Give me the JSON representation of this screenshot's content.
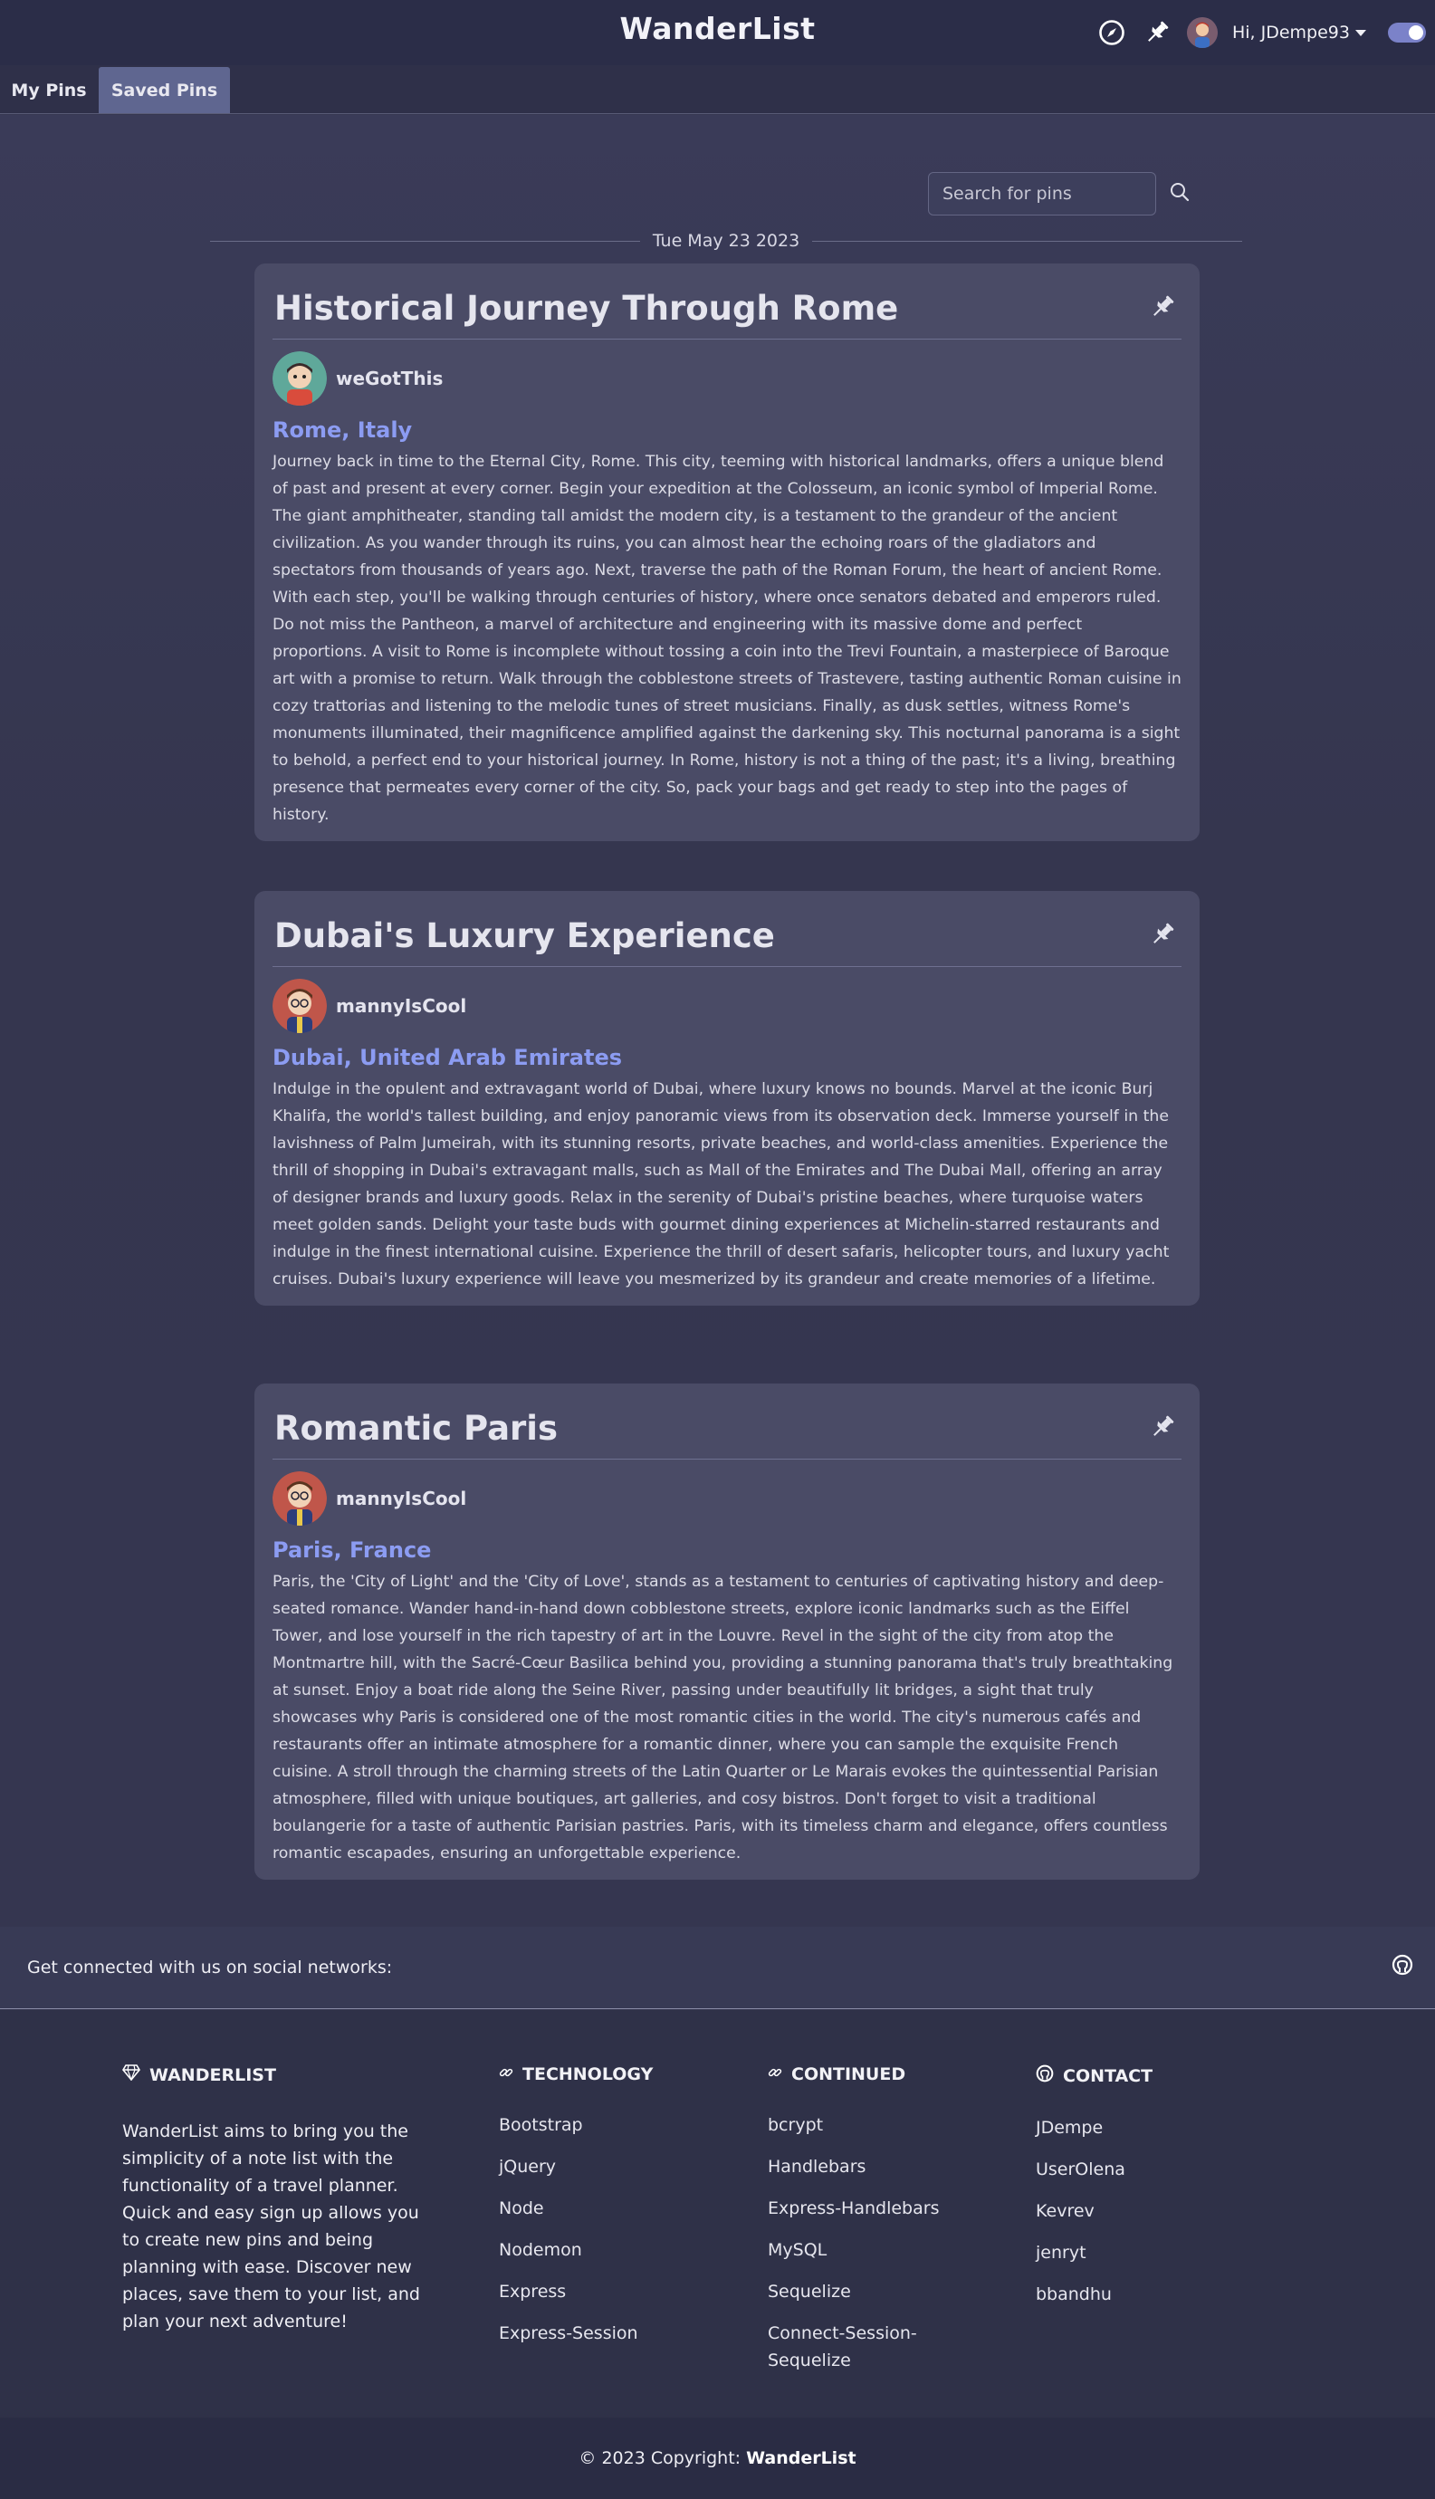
{
  "nav": {
    "brand": "WanderList",
    "greeting": "Hi, JDempe93"
  },
  "tabs": [
    {
      "label": "My Pins"
    },
    {
      "label": "Saved Pins"
    }
  ],
  "search": {
    "placeholder": "Search for pins"
  },
  "date": "Tue May 23 2023",
  "pins": [
    {
      "title": "Historical Journey Through Rome",
      "author": "weGotThis",
      "location": "Rome, Italy",
      "description": "Journey back in time to the Eternal City, Rome. This city, teeming with historical landmarks, offers a unique blend of past and present at every corner. Begin your expedition at the Colosseum, an iconic symbol of Imperial Rome. The giant amphitheater, standing tall amidst the modern city, is a testament to the grandeur of the ancient civilization. As you wander through its ruins, you can almost hear the echoing roars of the gladiators and spectators from thousands of years ago. Next, traverse the path of the Roman Forum, the heart of ancient Rome. With each step, you'll be walking through centuries of history, where once senators debated and emperors ruled. Do not miss the Pantheon, a marvel of architecture and engineering with its massive dome and perfect proportions. A visit to Rome is incomplete without tossing a coin into the Trevi Fountain, a masterpiece of Baroque art with a promise to return. Walk through the cobblestone streets of Trastevere, tasting authentic Roman cuisine in cozy trattorias and listening to the melodic tunes of street musicians. Finally, as dusk settles, witness Rome's monuments illuminated, their magnificence amplified against the darkening sky. This nocturnal panorama is a sight to behold, a perfect end to your historical journey. In Rome, history is not a thing of the past; it's a living, breathing presence that permeates every corner of the city. So, pack your bags and get ready to step into the pages of history."
    },
    {
      "title": "Dubai's Luxury Experience",
      "author": "mannyIsCool",
      "location": "Dubai, United Arab Emirates",
      "description": "Indulge in the opulent and extravagant world of Dubai, where luxury knows no bounds. Marvel at the iconic Burj Khalifa, the world's tallest building, and enjoy panoramic views from its observation deck. Immerse yourself in the lavishness of Palm Jumeirah, with its stunning resorts, private beaches, and world-class amenities. Experience the thrill of shopping in Dubai's extravagant malls, such as Mall of the Emirates and The Dubai Mall, offering an array of designer brands and luxury goods. Relax in the serenity of Dubai's pristine beaches, where turquoise waters meet golden sands. Delight your taste buds with gourmet dining experiences at Michelin-starred restaurants and indulge in the finest international cuisine. Experience the thrill of desert safaris, helicopter tours, and luxury yacht cruises. Dubai's luxury experience will leave you mesmerized by its grandeur and create memories of a lifetime."
    },
    {
      "title": "Romantic Paris",
      "author": "mannyIsCool",
      "location": "Paris, France",
      "description": "Paris, the 'City of Light' and the 'City of Love', stands as a testament to centuries of captivating history and deep-seated romance. Wander hand-in-hand down cobblestone streets, explore iconic landmarks such as the Eiffel Tower, and lose yourself in the rich tapestry of art in the Louvre. Revel in the sight of the city from atop the Montmartre hill, with the Sacré-Cœur Basilica behind you, providing a stunning panorama that's truly breathtaking at sunset. Enjoy a boat ride along the Seine River, passing under beautifully lit bridges, a sight that truly showcases why Paris is considered one of the most romantic cities in the world. The city's numerous cafés and restaurants offer an intimate atmosphere for a romantic dinner, where you can sample the exquisite French cuisine. A stroll through the charming streets of the Latin Quarter or Le Marais evokes the quintessential Parisian atmosphere, filled with unique boutiques, art galleries, and cosy bistros. Don't forget to visit a traditional boulangerie for a taste of authentic Parisian pastries. Paris, with its timeless charm and elegance, offers countless romantic escapades, ensuring an unforgettable experience."
    }
  ],
  "social": {
    "text": "Get connected with us on social networks:"
  },
  "footer": {
    "about_head": "WANDERLIST",
    "about_text": "WanderList aims to bring you the simplicity of a note list with the functionality of a travel planner. Quick and easy sign up allows you to create new pins and being planning with ease. Discover new places, save them to your list, and plan your next adventure!",
    "tech_head": "TECHNOLOGY",
    "tech": [
      "Bootstrap",
      "jQuery",
      "Node",
      "Nodemon",
      "Express",
      "Express-Session"
    ],
    "cont_head": "CONTINUED",
    "cont": [
      "bcrypt",
      "Handlebars",
      "Express-Handlebars",
      "MySQL",
      "Sequelize",
      "Connect-Session-Sequelize"
    ],
    "contact_head": "CONTACT",
    "contact": [
      "JDempe",
      "UserOlena",
      "Kevrev",
      "jenryt",
      "bbandhu"
    ],
    "copyright_prefix": "© 2023 Copyright:",
    "copyright_brand": "WanderList"
  }
}
